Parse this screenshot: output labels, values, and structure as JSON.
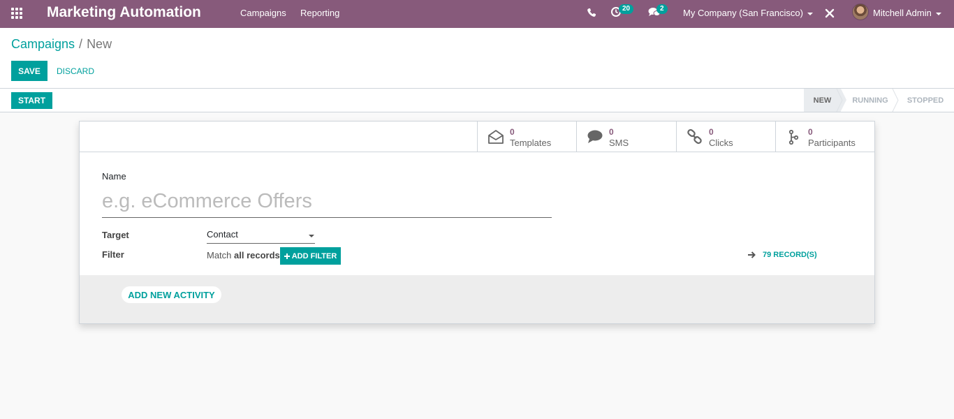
{
  "navbar": {
    "app_title": "Marketing Automation",
    "menu": [
      "Campaigns",
      "Reporting"
    ],
    "activity_count": "20",
    "message_count": "2",
    "company": "My Company (San Francisco)",
    "user": "Mitchell Admin",
    "color": "#875a7b"
  },
  "breadcrumb": {
    "parent": "Campaigns",
    "separator": "/",
    "current": "New"
  },
  "buttons": {
    "save": "SAVE",
    "discard": "DISCARD",
    "start": "START"
  },
  "stages": [
    "NEW",
    "RUNNING",
    "STOPPED"
  ],
  "active_stage": "NEW",
  "stat_buttons": [
    {
      "value": "0",
      "label": "Templates",
      "icon": "envelope-open-icon"
    },
    {
      "value": "0",
      "label": "SMS",
      "icon": "comment-icon"
    },
    {
      "value": "0",
      "label": "Clicks",
      "icon": "link-icon"
    },
    {
      "value": "0",
      "label": "Participants",
      "icon": "code-fork-icon"
    }
  ],
  "form": {
    "name_label": "Name",
    "name_placeholder": "e.g. eCommerce Offers",
    "name_value": "",
    "target_label": "Target",
    "target_value": "Contact",
    "filter_label": "Filter",
    "filter_prefix": "Match",
    "filter_scope": "all records",
    "add_filter": "ADD FILTER",
    "records": "79 RECORD(S)",
    "add_activity": "ADD NEW ACTIVITY"
  },
  "colors": {
    "accent": "#00a09d",
    "brand": "#875a7b"
  }
}
